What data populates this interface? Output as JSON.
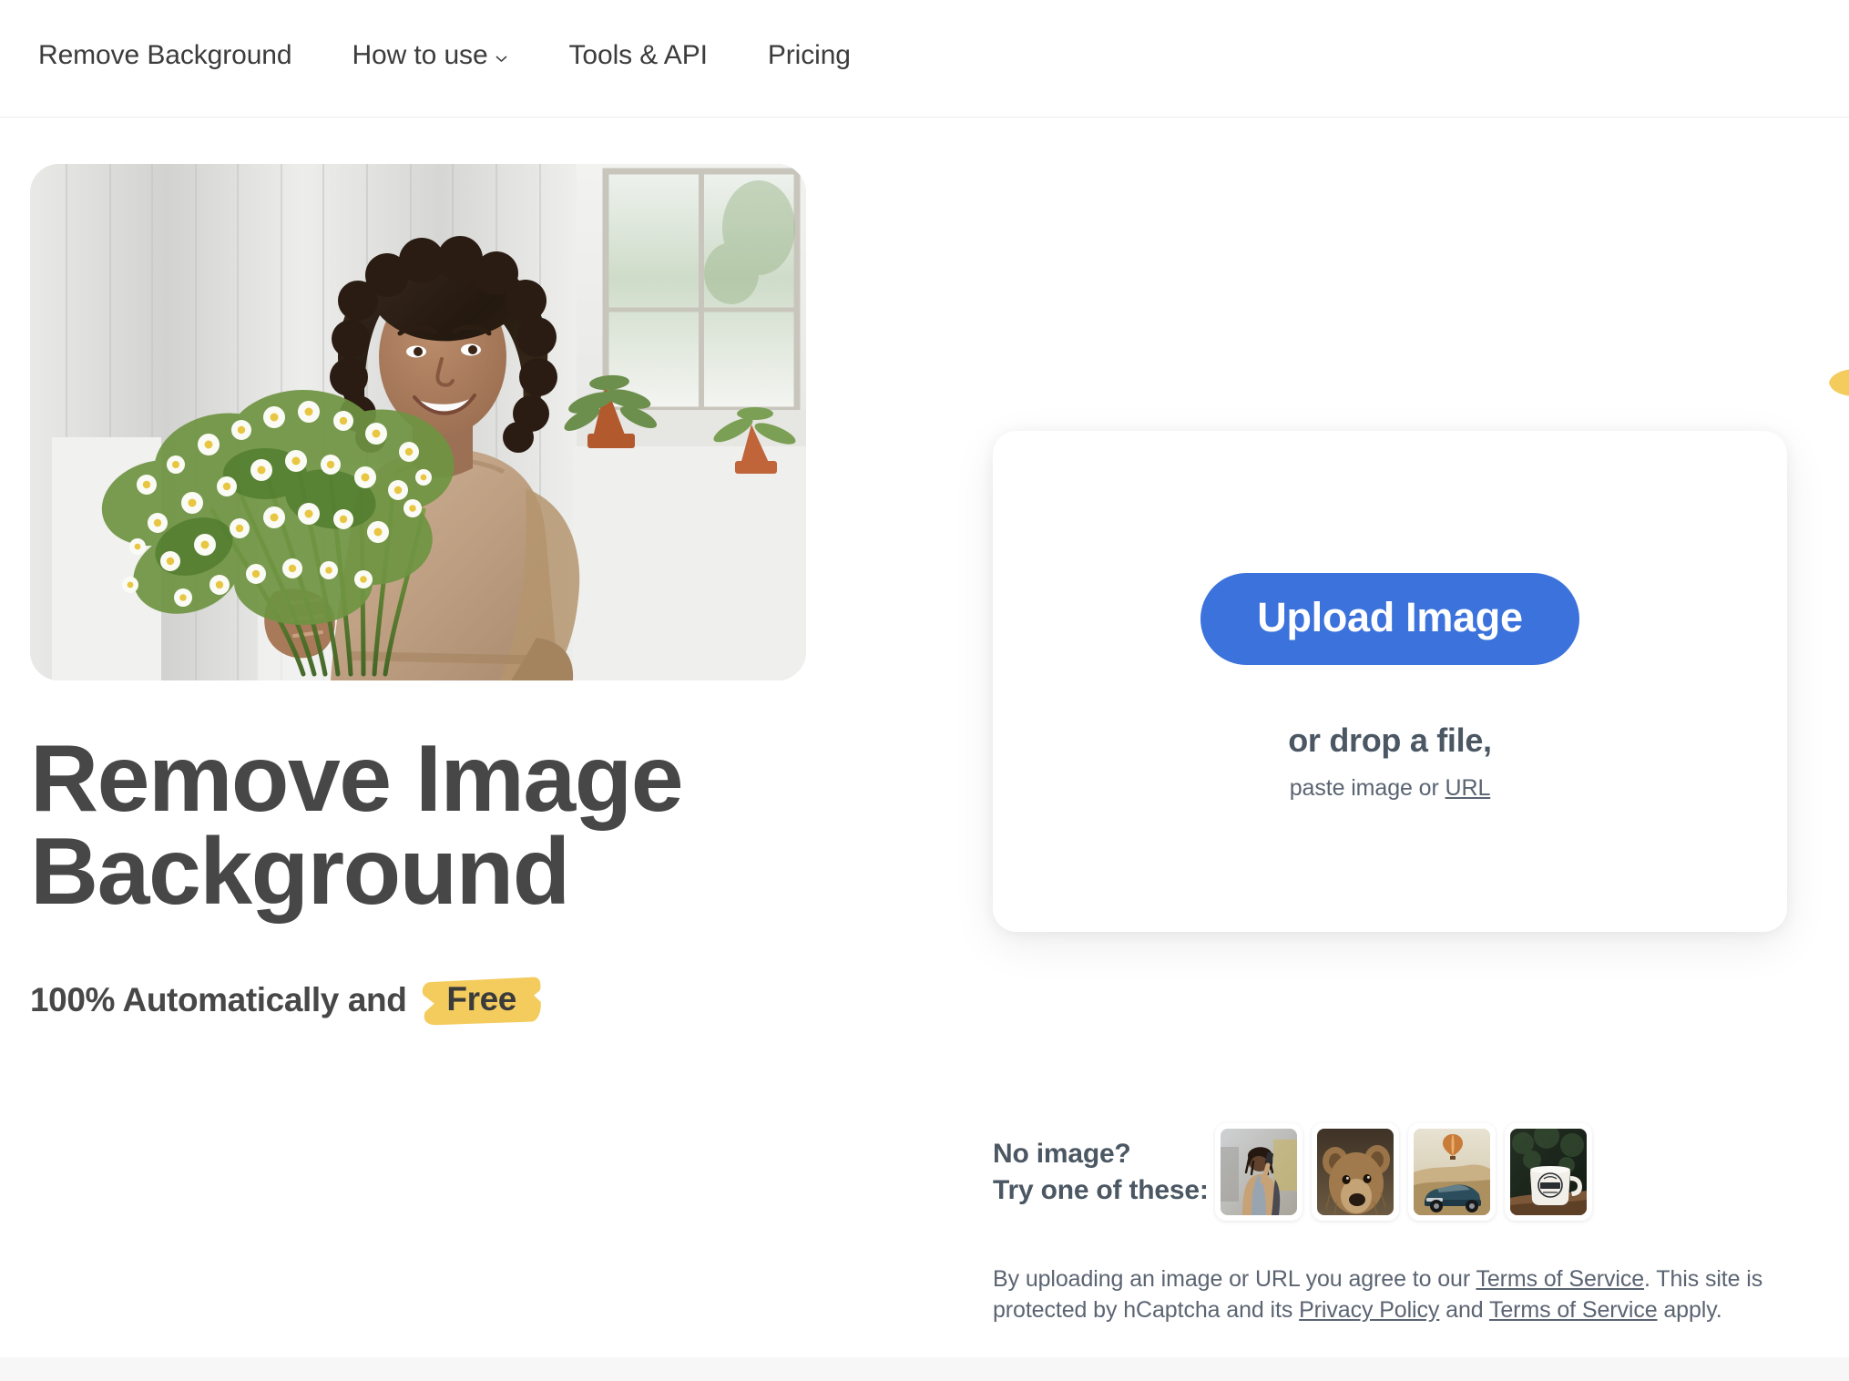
{
  "header": {
    "nav": [
      {
        "label": "Remove Background",
        "icon": null
      },
      {
        "label": "How to use",
        "icon": "chevron-down-icon"
      },
      {
        "label": "Tools & API",
        "icon": null
      },
      {
        "label": "Pricing",
        "icon": null
      }
    ]
  },
  "hero": {
    "photo_alt": "Smiling woman with curly dark hair in a tan blouse holding a large bouquet of white daisies in a bright white interior",
    "title_line1": "Remove Image",
    "title_line2": "Background",
    "subtitle_prefix": "100% Automatically and",
    "subtitle_highlight": "Free"
  },
  "upload": {
    "button_label": "Upload Image",
    "drop_text": "or drop a file,",
    "paste_prefix": "paste image or ",
    "paste_link": "URL"
  },
  "samples": {
    "label_line1": "No image?",
    "label_line2": "Try one of these:",
    "thumbnails": [
      {
        "name": "sample-person-phone",
        "alt": "Person with dreadlocks in tan coat talking on a phone"
      },
      {
        "name": "sample-bear",
        "alt": "Brown grizzly bear portrait"
      },
      {
        "name": "sample-car-balloon",
        "alt": "Vintage teal convertible car in the desert with a hot air balloon"
      },
      {
        "name": "sample-coffee-mug",
        "alt": "White enamel COFFEE mug on a wooden table"
      }
    ]
  },
  "legal": {
    "part1": "By uploading an image or URL you agree to our ",
    "link1": "Terms of Service",
    "part2": ". This site is protected by hCaptcha and its ",
    "link2": "Privacy Policy",
    "part3": " and ",
    "link3": "Terms of Service",
    "part4": " apply."
  },
  "colors": {
    "accent_blue": "#3b72db",
    "highlight_yellow": "#f4cc5e",
    "heading": "#474747",
    "muted_text": "#5b6472",
    "page_bg": "#ffffff"
  }
}
